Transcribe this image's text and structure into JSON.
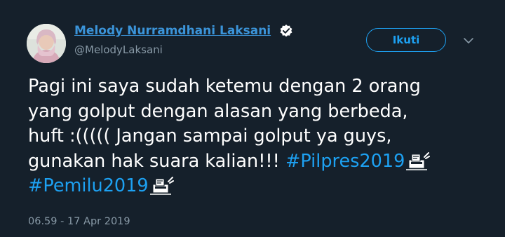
{
  "author": {
    "display_name": "Melody Nurramdhani Laksani",
    "handle": "@MelodyLaksani",
    "verified_icon": "verified-badge-icon",
    "avatar_icon": "profile-avatar"
  },
  "actions": {
    "follow_label": "Ikuti",
    "menu_icon": "chevron-down-icon"
  },
  "tweet": {
    "line1": "Pagi ini saya sudah ketemu dengan 2 orang",
    "line2": "yang golput dengan alasan yang berbeda,",
    "line3": "huft :((((( Jangan sampai golput ya guys,",
    "line4_text": "gunakan hak suara kalian!!! ",
    "hashtag1": "#Pilpres2019",
    "hashtag2": "#Pemilu2019",
    "emoji_icon": "ballot-box-emoji"
  },
  "meta": {
    "timestamp": "06.59 - 17 Apr 2019"
  },
  "colors": {
    "background": "#15202b",
    "link": "#1da1f2",
    "name_link": "#3b94d9",
    "secondary_text": "#8899a6",
    "text": "#ffffff"
  }
}
